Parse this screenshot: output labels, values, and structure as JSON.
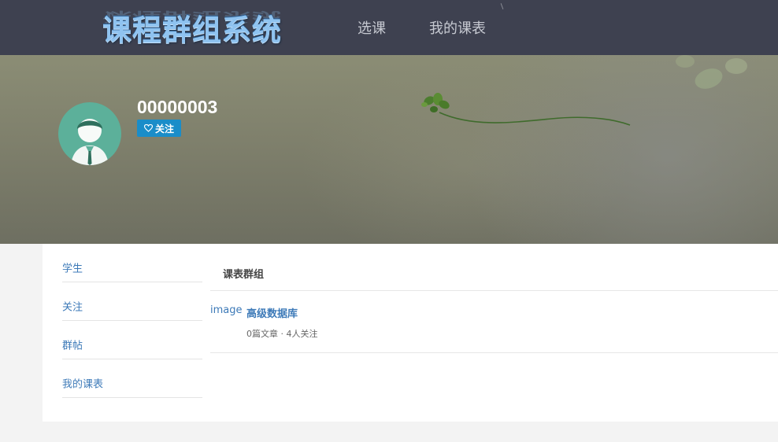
{
  "header": {
    "logo_text": "课程群组系统",
    "nav": [
      {
        "label": "选课"
      },
      {
        "label": "我的课表"
      }
    ]
  },
  "profile": {
    "username": "00000003",
    "follow_label": "关注",
    "follow_icon": "heart-outline-icon"
  },
  "sidebar": {
    "items": [
      {
        "label": "学生"
      },
      {
        "label": "关注"
      },
      {
        "label": "群帖"
      },
      {
        "label": "我的课表"
      }
    ]
  },
  "main": {
    "title": "课表群组",
    "groups": [
      {
        "image_alt": "image",
        "name": "高级数据库",
        "meta": "0篇文章 · 4人关注"
      }
    ]
  },
  "colors": {
    "topbar": "#3e4150",
    "link": "#3d7ab8",
    "follow_button": "#1a8dc9",
    "avatar_bg": "#5cb09a"
  }
}
